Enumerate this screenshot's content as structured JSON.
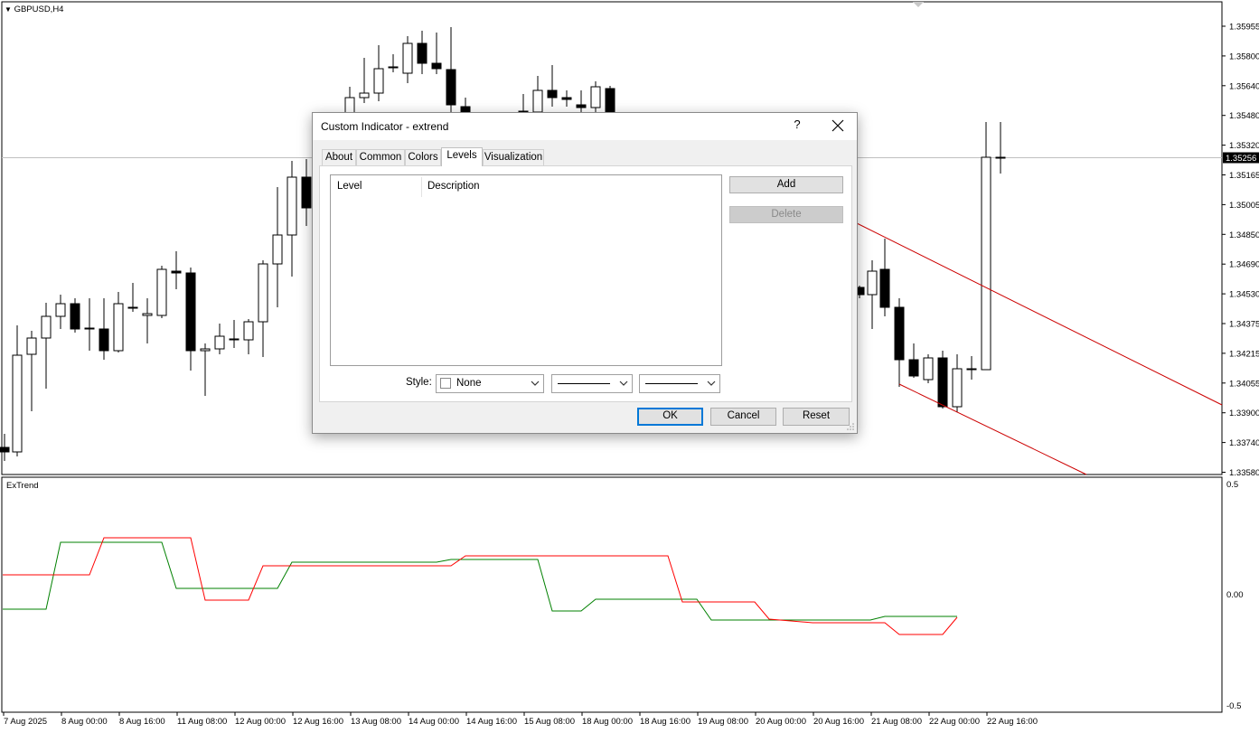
{
  "chart": {
    "symbol_label": "GBPUSD,H4",
    "price_ticks": [
      "1.35955",
      "1.35800",
      "1.35640",
      "1.35480",
      "1.35320",
      "1.35165",
      "1.35005",
      "1.34850",
      "1.34690",
      "1.34530",
      "1.34375",
      "1.34215",
      "1.34055",
      "1.33900",
      "1.33740",
      "1.33580"
    ],
    "current_price": "1.35256",
    "time_ticks": [
      "7 Aug 2025",
      "8 Aug 00:00",
      "8 Aug 16:00",
      "11 Aug 08:00",
      "12 Aug 00:00",
      "12 Aug 16:00",
      "13 Aug 08:00",
      "14 Aug 00:00",
      "14 Aug 16:00",
      "15 Aug 08:00",
      "18 Aug 00:00",
      "18 Aug 16:00",
      "19 Aug 08:00",
      "20 Aug 00:00",
      "20 Aug 16:00",
      "21 Aug 08:00",
      "22 Aug 00:00",
      "22 Aug 16:00"
    ],
    "indicator_label": "ExTrend",
    "indicator_ticks": [
      "0.5",
      "0.00",
      "-0.5"
    ],
    "colors": {
      "bull_line": "#008000",
      "bear_line": "#ff0000",
      "channel": "#cc0000"
    }
  },
  "dialog": {
    "title": "Custom Indicator - extrend",
    "help_label": "?",
    "tabs": [
      {
        "label": "About"
      },
      {
        "label": "Common"
      },
      {
        "label": "Colors"
      },
      {
        "label": "Levels",
        "active": true
      },
      {
        "label": "Visualization"
      }
    ],
    "levels_table": {
      "col_level": "Level",
      "col_description": "Description",
      "rows": []
    },
    "add_label": "Add",
    "delete_label": "Delete",
    "style_label": "Style:",
    "color_value": "None",
    "ok_label": "OK",
    "cancel_label": "Cancel",
    "reset_label": "Reset"
  }
}
